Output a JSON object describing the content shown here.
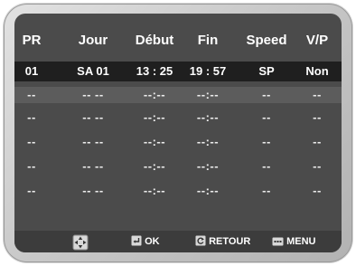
{
  "header": {
    "col_pr": "PR",
    "col_jour": "Jour",
    "col_debut": "Début",
    "col_fin": "Fin",
    "col_speed": "Speed",
    "col_vp": "V/P"
  },
  "record": {
    "pr": "01",
    "jour": "SA  01",
    "debut": "13 : 25",
    "fin": "19 : 57",
    "speed": "SP",
    "vp": "Non"
  },
  "empty_row": {
    "pr": "--",
    "jour": "-- --",
    "debut": "--:--",
    "fin": "--:--",
    "speed": "--",
    "vp": "--"
  },
  "footer": {
    "move_icon": "four-way-arrow-icon",
    "ok_icon": "enter-key-icon",
    "ok_label": "OK",
    "retour_icon": "return-arrow-icon",
    "retour_label": "RETOUR",
    "menu_icon": "menu-key-icon",
    "menu_label": "MENU"
  },
  "colors": {
    "screen_bg": "#4b4b4b",
    "record_row_bg": "#1f1f1f",
    "selected_row_bg": "#5c5c5c",
    "footer_bg": "#3c3c3c",
    "text": "#ffffff"
  }
}
